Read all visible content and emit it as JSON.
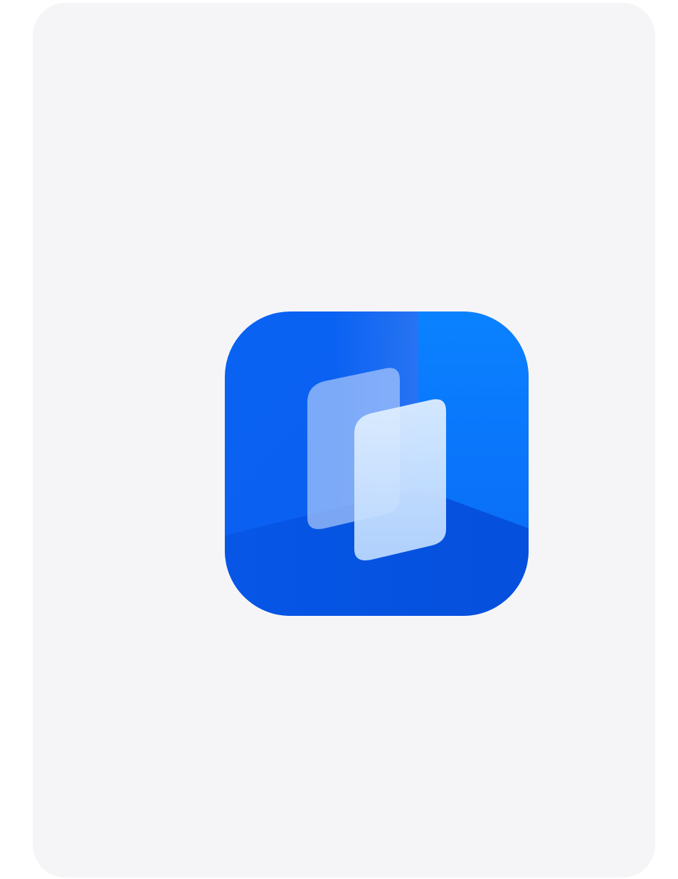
{
  "splash": {
    "icon": "layered-cards-app-icon",
    "background_color": "#f5f5f7",
    "icon_colors": {
      "primary": "#0b63f0",
      "accent": "#0078ff",
      "dark": "#0450d8",
      "back_card": "#9cbdf8",
      "front_card": "#d9ebff"
    }
  }
}
